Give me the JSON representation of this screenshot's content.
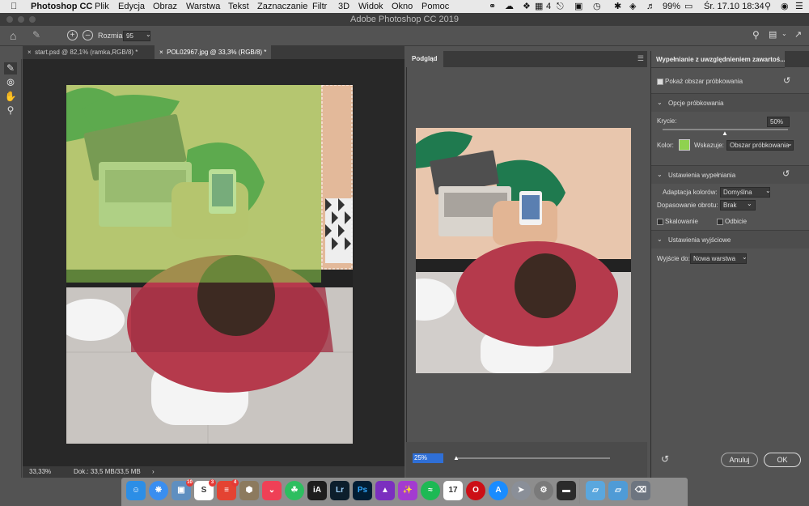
{
  "menubar": {
    "app_name": "Photoshop CC",
    "items": [
      "Plik",
      "Edycja",
      "Obraz",
      "Warstwa",
      "Tekst",
      "Zaznaczanie",
      "Filtr",
      "3D",
      "Widok",
      "Okno",
      "Pomoc"
    ],
    "status": {
      "notifications": "4",
      "battery": "99%",
      "datetime": "Śr. 17.10  18:34"
    }
  },
  "window": {
    "title": "Adobe Photoshop CC 2019"
  },
  "options_bar": {
    "size_label": "Rozmiar:",
    "size_value": "95"
  },
  "tabs": [
    {
      "label": "start.psd @ 82,1% (ramka,RGB/8) *"
    },
    {
      "label": "POL02967.jpg @ 33,3% (RGB/8) *"
    }
  ],
  "status_bar": {
    "zoom": "33,33%",
    "doc": "Dok.: 33,5 MB/33,5 MB"
  },
  "preview": {
    "tab_label": "Podgląd",
    "zoom_value": "25%"
  },
  "panel": {
    "title": "Wypełnianie z uwzględnieniem zawartoś...",
    "show_sampling": "Pokaż obszar próbkowania",
    "sampling_options": "Opcje próbkowania",
    "opacity_label": "Krycie:",
    "opacity_value": "50%",
    "color_label": "Kolor:",
    "indicates_label": "Wskazuje:",
    "indicates_value": "Obszar próbkowania",
    "fill_settings": "Ustawienia wypełniania",
    "color_adapt_label": "Adaptacja kolorów:",
    "color_adapt_value": "Domyślna",
    "rotation_label": "Dopasowanie obrotu:",
    "rotation_value": "Brak",
    "scaling_label": "Skalowanie",
    "mirror_label": "Odbicie",
    "output_settings": "Ustawienia wyjściowe",
    "output_label": "Wyjście do:",
    "output_value": "Nowa warstwa",
    "cancel_label": "Anuluj",
    "ok_label": "OK"
  },
  "colors": {
    "sampling_overlay": "#8fd24f",
    "accent_blue": "#2f6fd6"
  },
  "dock": {
    "icons": [
      "finder",
      "safari",
      "preview",
      "slack",
      "todoist",
      "keychain",
      "pocket",
      "evernote",
      "ia-writer",
      "lightroom",
      "photoshop",
      "affinity",
      "screens",
      "spotify",
      "calendar",
      "opera",
      "app-store",
      "launchpad",
      "system-preferences",
      "display",
      "folder",
      "folder",
      "trash"
    ],
    "badges": {
      "preview": "10",
      "slack": "3",
      "todoist": "4"
    },
    "lr_label": "Lr",
    "ps_label": "Ps",
    "ia_label": "iA",
    "cal_label": "17"
  }
}
